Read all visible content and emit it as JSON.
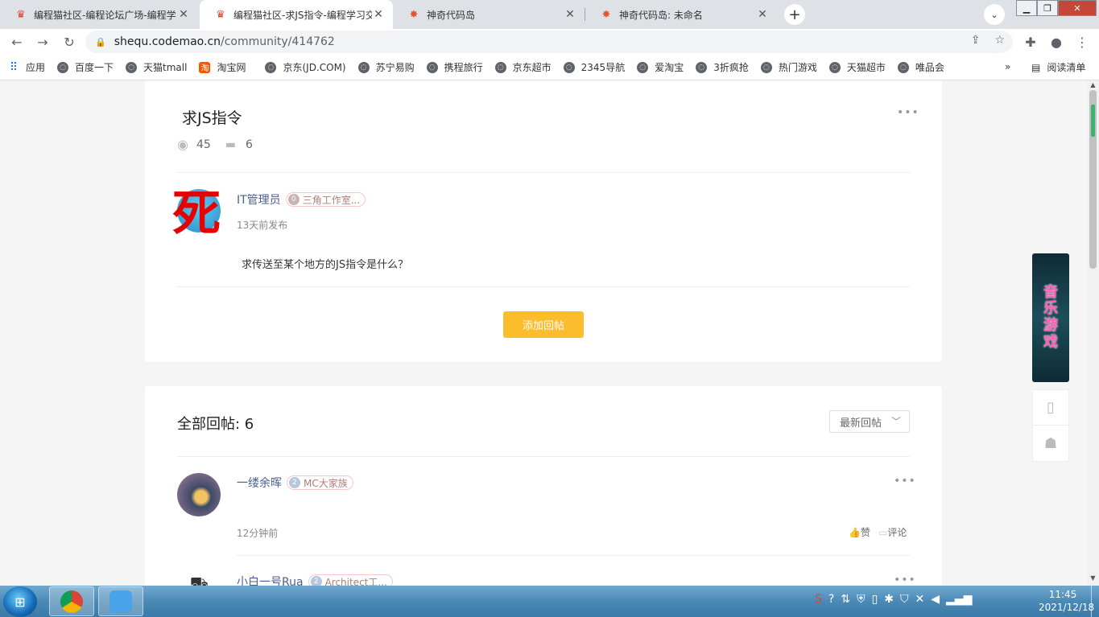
{
  "browser": {
    "tabs": [
      {
        "title": "编程猫社区-编程论坛广场-编程学",
        "active": false,
        "favicon": "codemao-icon"
      },
      {
        "title": "编程猫社区-求JS指令-编程学习交",
        "active": true,
        "favicon": "codemao-icon"
      },
      {
        "title": "神奇代码岛",
        "active": false,
        "favicon": "codeisland-icon"
      },
      {
        "title": "神奇代码岛: 未命名",
        "active": false,
        "favicon": "codeisland-icon"
      }
    ],
    "url": {
      "host": "shequ.codemao.cn",
      "path": "/community/414762"
    },
    "bookmarks": [
      {
        "label": "应用"
      },
      {
        "label": "百度一下"
      },
      {
        "label": "天猫tmall"
      },
      {
        "label": "淘宝网"
      },
      {
        "label": "京东(JD.COM)"
      },
      {
        "label": "苏宁易购"
      },
      {
        "label": "携程旅行"
      },
      {
        "label": "京东超市"
      },
      {
        "label": "2345导航"
      },
      {
        "label": "爱淘宝"
      },
      {
        "label": "3折疯抢"
      },
      {
        "label": "热门游戏"
      },
      {
        "label": "天猫超市"
      },
      {
        "label": "唯品会"
      }
    ],
    "bookmarks_more": "»",
    "reading_list": "阅读清单"
  },
  "post": {
    "title": "求JS指令",
    "views": "45",
    "comments": "6",
    "author": "IT管理员",
    "author_badge_level": "0",
    "author_badge": "三角工作室...",
    "posted": "13天前发布",
    "overlay_char": "死",
    "body": "求传送至某个地方的JS指令是什么？",
    "add_reply": "添加回帖"
  },
  "replies": {
    "heading": "全部回帖: 6",
    "sort": "最新回帖",
    "items": [
      {
        "author": "一缕余晖",
        "badge_level": "2",
        "badge": "MC大家族",
        "time": "12分钟前",
        "like": "赞",
        "comment": "评论"
      },
      {
        "author": "小白一号Rua",
        "badge_level": "2",
        "badge": "Architect工..."
      }
    ]
  },
  "sidebar": {
    "promo": [
      "音",
      "乐",
      "游",
      "戏"
    ]
  },
  "taskbar": {
    "time": "11:45",
    "date": "2021/12/18"
  }
}
